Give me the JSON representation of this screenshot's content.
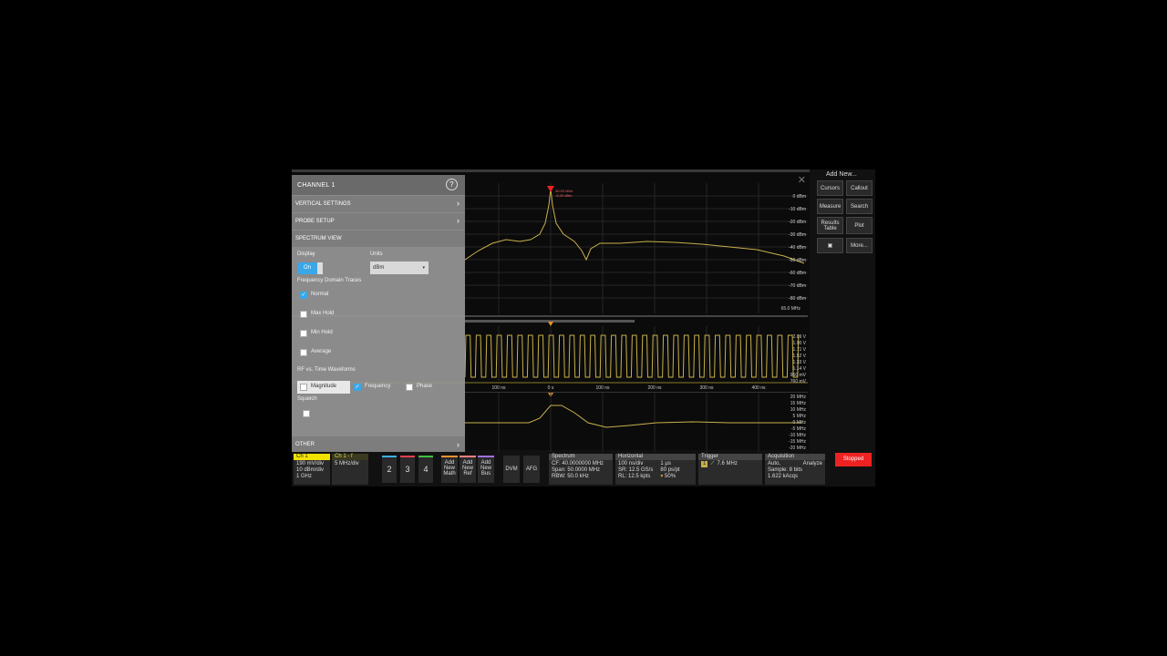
{
  "spectrum": {
    "ref_labels": [
      "0 dBm",
      "-10 dBm",
      "-20 dBm",
      "-30 dBm",
      "-40 dBm",
      "-50 dBm",
      "-60 dBm",
      "-70 dBm",
      "-80 dBm"
    ],
    "freq_label": "65.0 MHz",
    "marker_top": "40.00 MHz",
    "marker_bottom": "-8.20 dBm"
  },
  "time": {
    "volt_labels": [
      "2.09 V",
      "1.90 V",
      "1.71 V",
      "1.52 V",
      "1.33 V",
      "1.14 V",
      "950 mV",
      "760 mV"
    ],
    "time_labels": [
      "100 ns",
      "0 s",
      "100 ns",
      "200 ns",
      "300 ns",
      "400 ns"
    ]
  },
  "freq_track": {
    "labels": [
      "20 MHz",
      "15 MHz",
      "10 MHz",
      "5 MHz",
      "0 MHz",
      "-5 MHz",
      "-10 MHz",
      "-15 MHz",
      "-20 MHz"
    ]
  },
  "panel": {
    "title": "CHANNEL 1",
    "help": "?",
    "sections": [
      "VERTICAL SETTINGS",
      "PROBE SETUP",
      "SPECTRUM VIEW"
    ],
    "display_label": "Display",
    "toggle_label": "On",
    "units_label": "Units",
    "units_value": "dBm",
    "fdt_label": "Frequency Domain Traces",
    "traces": [
      "Normal",
      "Max Hold",
      "Min Hold",
      "Average"
    ],
    "rf_label": "RF vs. Time Waveforms",
    "rf_options": [
      "Magnitude",
      "Frequency",
      "Phase"
    ],
    "squelch_label": "Squelch",
    "other_label": "OTHER"
  },
  "add_new": {
    "title": "Add New...",
    "buttons": [
      "Cursors",
      "Callout",
      "Measure",
      "Search",
      "Results Table",
      "Plot",
      "More..."
    ]
  },
  "bottom": {
    "ch1": {
      "header": "Ch 1",
      "lines": [
        "190 mV/div",
        "10 dBm/div",
        "1 GHz"
      ]
    },
    "ch1f": {
      "header": "Ch 1 - f",
      "lines": [
        "5 MHz/div"
      ]
    },
    "channels": [
      "2",
      "3",
      "4"
    ],
    "add_math": "Add New Math",
    "add_ref": "Add New Ref",
    "add_bus": "Add New Bus",
    "dvm": "DVM",
    "afg": "AFG",
    "spectrum": {
      "header": "Spectrum",
      "lines": [
        "CF: 40.0000000 MHz",
        "Span: 50.0000 MHz",
        "RBW: 50.0 kHz"
      ]
    },
    "horizontal": {
      "header": "Horizontal",
      "lines": [
        "100 ns/div",
        "SR: 12.5 GS/s",
        "RL: 12.5 kpts"
      ],
      "col2": [
        "1 µs",
        "80 ps/pt",
        "50%"
      ]
    },
    "trigger": {
      "header": "Trigger",
      "value": "7.6 MHz",
      "slot": "1"
    },
    "acquisition": {
      "header": "Acquisition",
      "lines": [
        "Auto,",
        "Sample: 8 bits",
        "1.622 kAcqs"
      ],
      "analyze": "Analyze"
    },
    "stopped": "Stopped"
  },
  "colors": {
    "trace": "#c8b04a",
    "accent": "#3aa7e6",
    "stopped": "#e02020"
  }
}
